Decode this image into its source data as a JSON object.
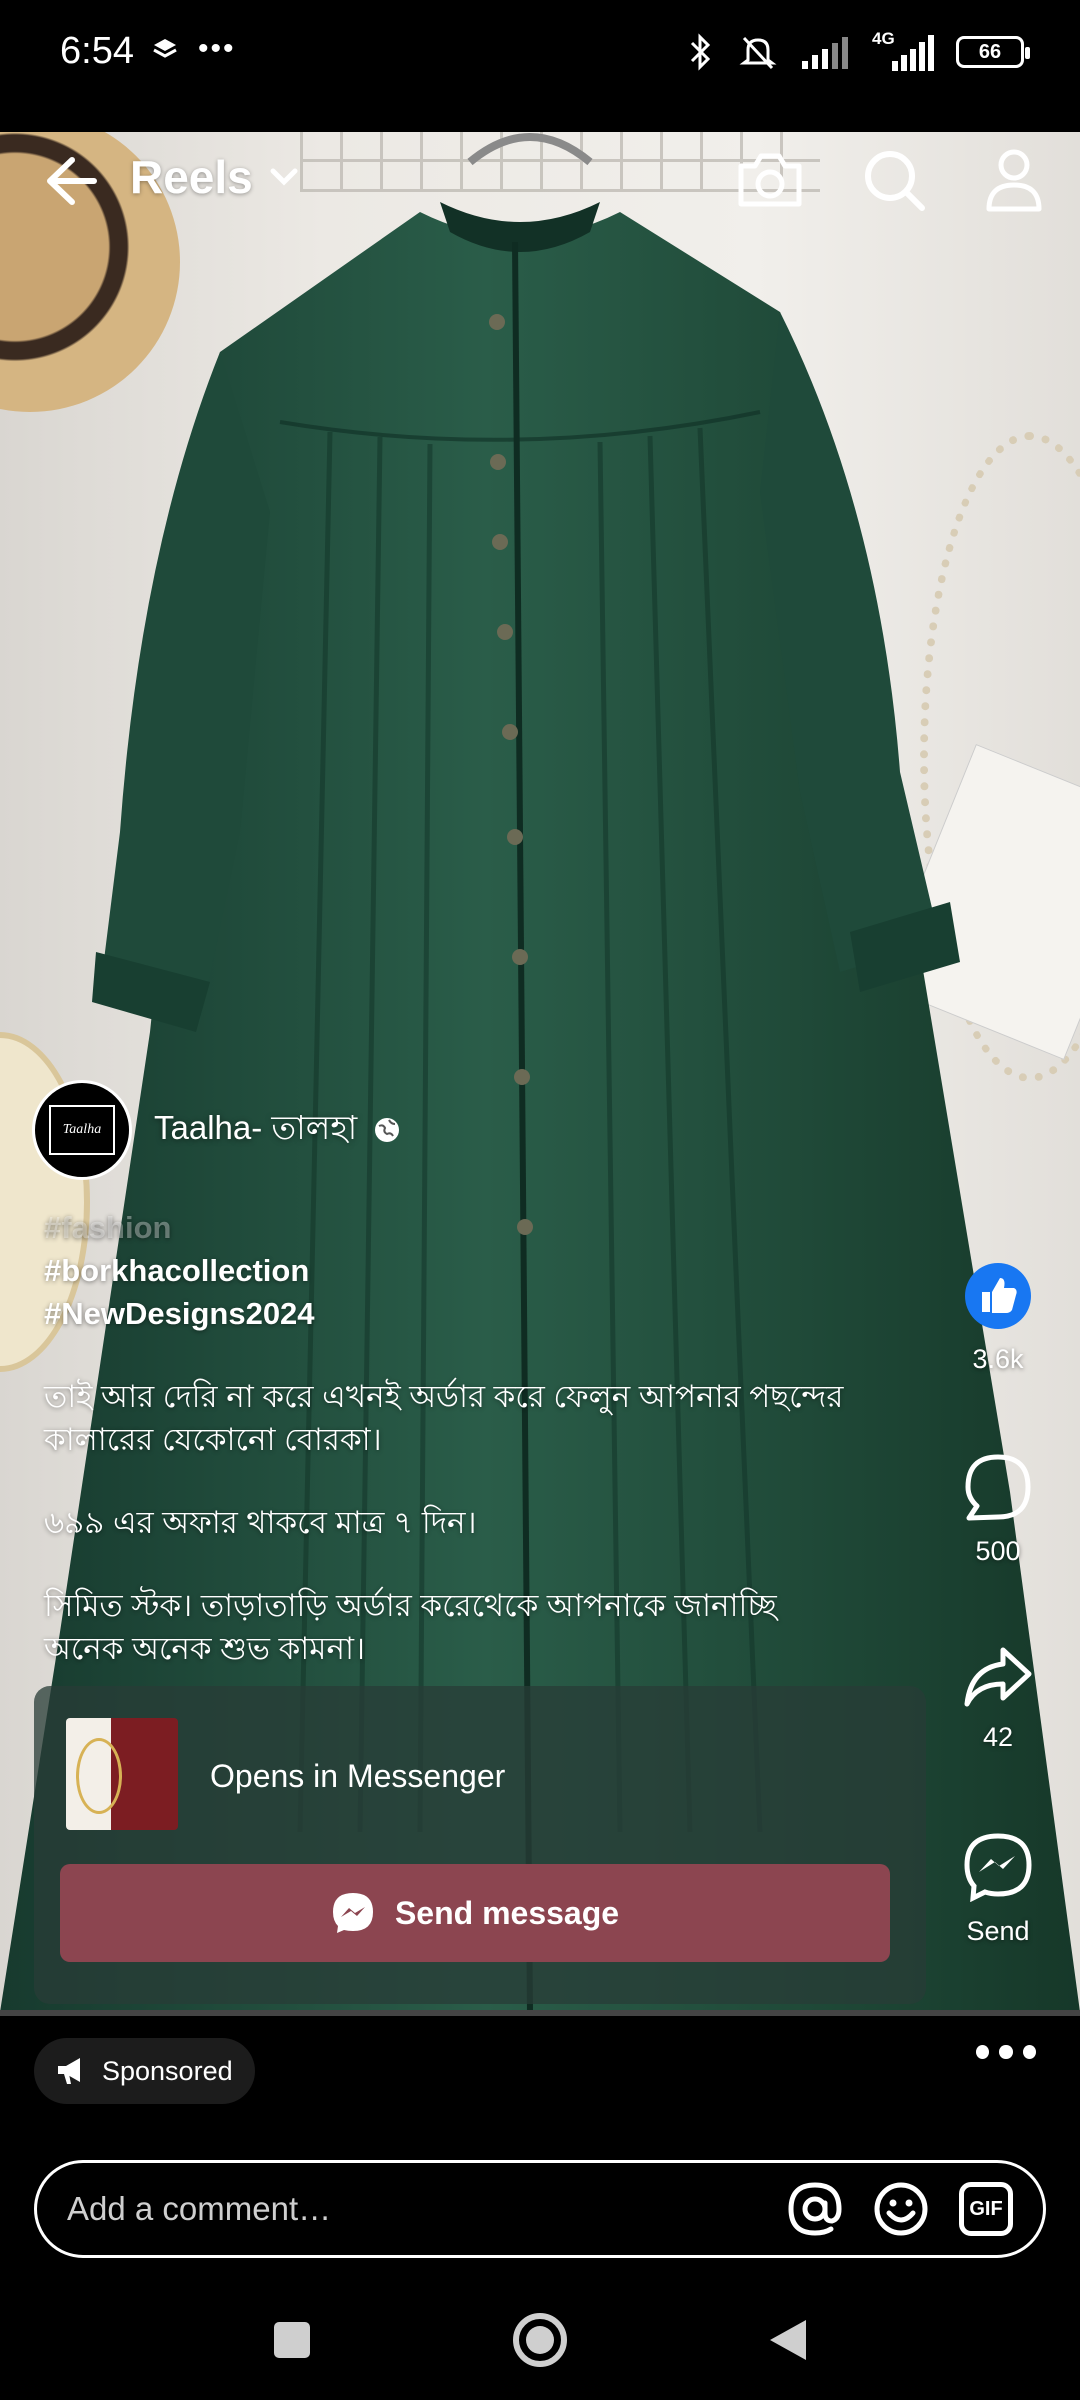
{
  "status_bar": {
    "time": "6:54",
    "network": "4G",
    "battery": "66"
  },
  "top_bar": {
    "title": "Reels",
    "icons": [
      "back-arrow-icon",
      "chevron-down-icon",
      "camera-icon",
      "search-icon",
      "profile-icon"
    ]
  },
  "post": {
    "author": "Taalha- তালহা",
    "avatar_text": "Taalha",
    "hashtags": [
      "#fashion",
      "#borkhacollection",
      "#NewDesigns2024"
    ],
    "paragraphs": [
      "তাই আর দেরি না করে এখনই অর্ডার করে ফেলুন আপনার পছন্দের কালারের যেকোনো বোরকা।",
      "৬৯৯ এর অফার থাকবে মাত্র ৭ দিন।",
      "সিমিত স্টক। তাড়াতাড়ি অর্ডার করেথেকে আপনাকে জানাচ্ছি অনেক অনেক শুভ কামনা।"
    ]
  },
  "actions": {
    "likes": "3.6k",
    "comments": "500",
    "shares": "42",
    "send_label": "Send"
  },
  "messenger_card": {
    "opens_text": "Opens in Messenger",
    "button_label": "Send message"
  },
  "bottom": {
    "sponsored_label": "Sponsored",
    "comment_placeholder": "Add a comment…",
    "gif_label": "GIF"
  },
  "colors": {
    "dress": "#1f4d3c",
    "send_button": "#8c4550",
    "like_blue": "#1877f2"
  }
}
